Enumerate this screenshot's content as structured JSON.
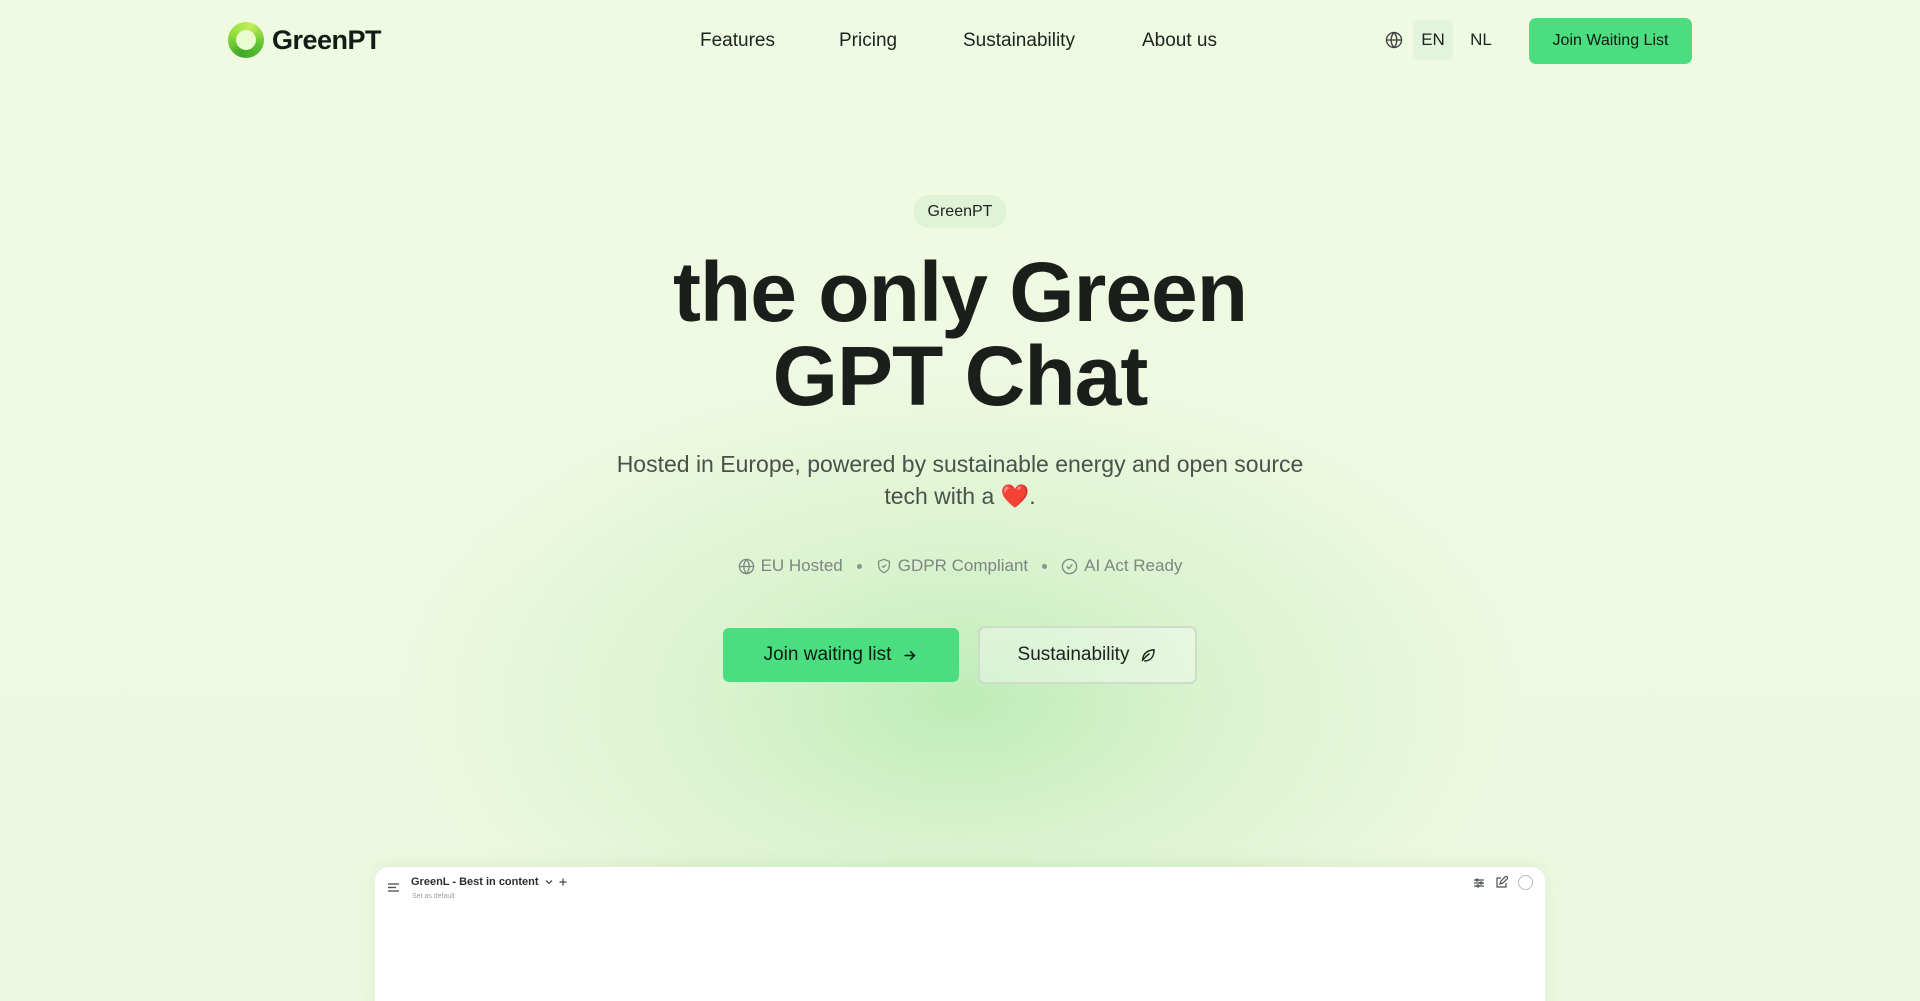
{
  "brand": {
    "name": "GreenPT"
  },
  "nav": {
    "links": [
      "Features",
      "Pricing",
      "Sustainability",
      "About us"
    ],
    "languages": [
      "EN",
      "NL"
    ],
    "active_language": "EN",
    "cta_label": "Join Waiting List"
  },
  "hero": {
    "pill": "GreenPT",
    "headline_line1": "the only Green",
    "headline_line2": "GPT Chat",
    "subtitle_line1": "Hosted in Europe, powered by sustainable energy and open source",
    "subtitle_line2": "tech with a",
    "subtitle_end": ".",
    "badges": [
      "EU Hosted",
      "GDPR Compliant",
      "AI Act Ready"
    ],
    "primary_cta": "Join waiting list",
    "secondary_cta": "Sustainability"
  },
  "preview": {
    "model_name": "GreenL - Best in content",
    "set_default": "Set as default"
  },
  "colors": {
    "accent": "#4ade80",
    "background": "#f0f9e2",
    "heart": "#e53935"
  }
}
